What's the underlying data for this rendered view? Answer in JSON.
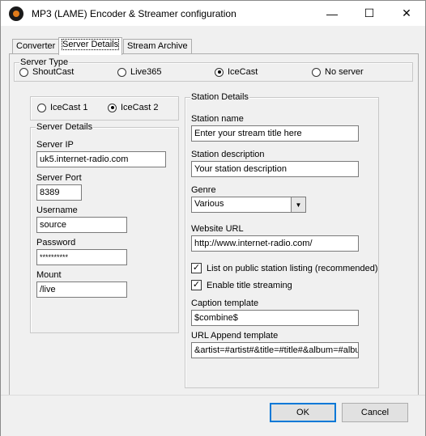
{
  "window": {
    "title": "MP3 (LAME) Encoder & Streamer configuration",
    "minimize_glyph": "—",
    "maximize_glyph": "☐",
    "close_glyph": "✕"
  },
  "tabs": [
    {
      "label": "Converter"
    },
    {
      "label": "Server Details",
      "selected": true
    },
    {
      "label": "Stream Archive"
    }
  ],
  "server_type": {
    "label": "Server Type",
    "options": [
      "ShoutCast",
      "Live365",
      "IceCast",
      "No server"
    ],
    "selected": "IceCast"
  },
  "icecast_version": {
    "options": [
      "IceCast 1",
      "IceCast 2"
    ],
    "selected": "IceCast 2"
  },
  "server_details": {
    "label": "Server Details",
    "server_ip_label": "Server IP",
    "server_ip": "uk5.internet-radio.com",
    "server_port_label": "Server Port",
    "server_port": "8389",
    "username_label": "Username",
    "username": "source",
    "password_label": "Password",
    "password": "**********",
    "mount_label": "Mount",
    "mount": "/live"
  },
  "station_details": {
    "label": "Station Details",
    "name_label": "Station name",
    "name": "Enter your stream title here",
    "description_label": "Station description",
    "description": "Your station description",
    "genre_label": "Genre",
    "genre": "Various",
    "website_label": "Website URL",
    "website": "http://www.internet-radio.com/",
    "list_public_label": "List on public station listing (recommended)",
    "list_public_checked": true,
    "title_streaming_label": "Enable title streaming",
    "title_streaming_checked": true,
    "caption_label": "Caption template",
    "caption": "$combine$",
    "url_append_label": "URL Append template",
    "url_append": "&artist=#artist#&title=#title#&album=#album#"
  },
  "buttons": {
    "ok": "OK",
    "cancel": "Cancel"
  },
  "check_glyph": "✓",
  "dropdown_glyph": "▼"
}
